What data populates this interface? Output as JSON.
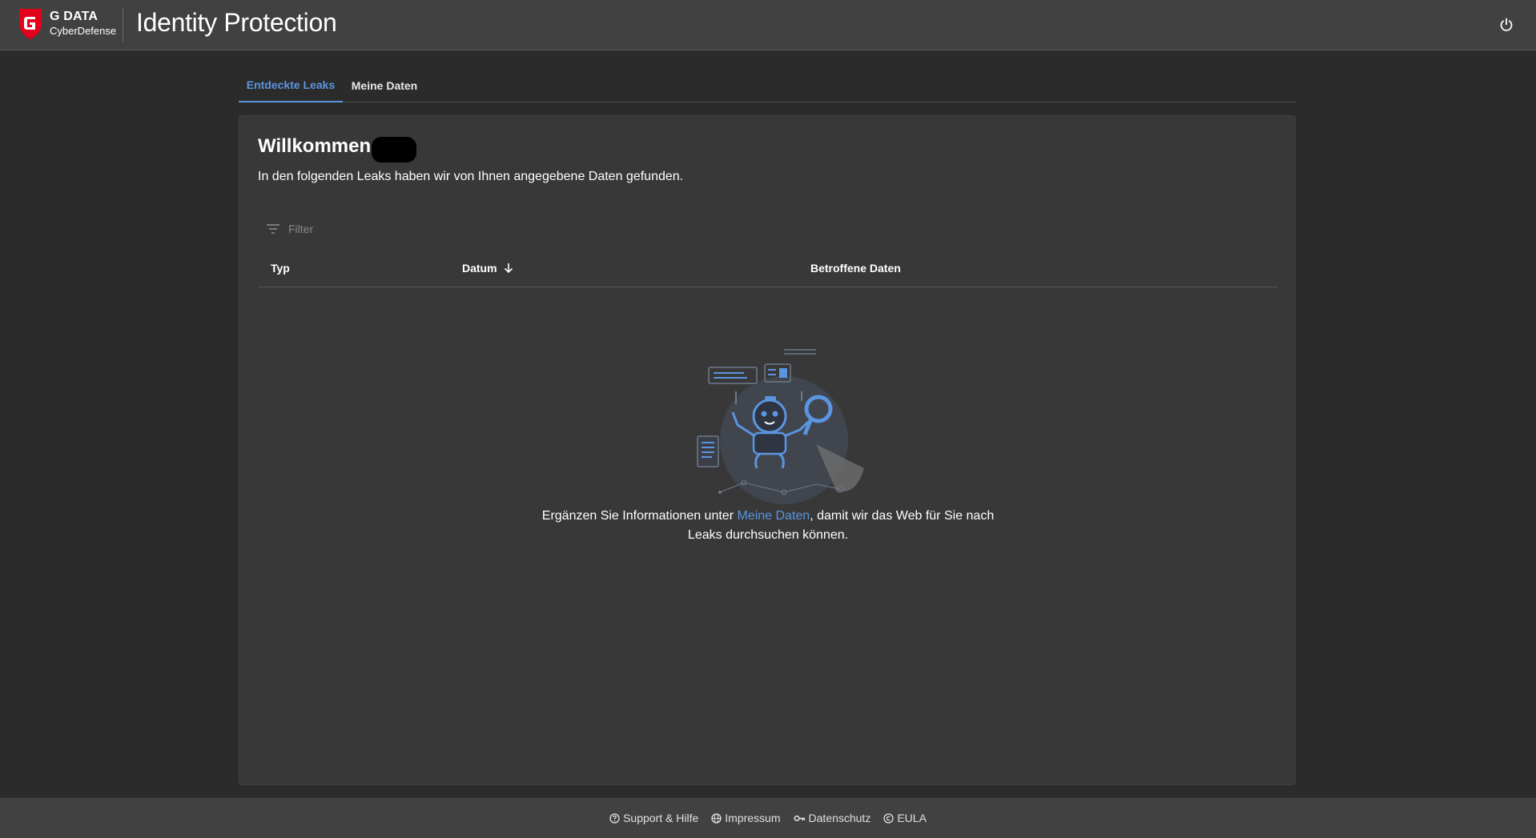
{
  "header": {
    "brand_line1": "G DATA",
    "brand_line2": "CyberDefense",
    "app_title": "Identity Protection",
    "power_icon": "power-icon"
  },
  "tabs": [
    {
      "label": "Entdeckte Leaks",
      "active": true
    },
    {
      "label": "Meine Daten",
      "active": false
    }
  ],
  "main": {
    "welcome": "Willkommen,",
    "subtitle": "In den folgenden Leaks haben wir von Ihnen angegebene Daten gefunden.",
    "filter_placeholder": "Filter",
    "columns": [
      "Typ",
      "Datum",
      "Betroffene Daten"
    ],
    "sort_icon": "arrow-down-icon",
    "empty": {
      "text_before": "Ergänzen Sie Informationen unter ",
      "link": "Meine Daten",
      "text_after": ", damit wir das Web für Sie nach Leaks durchsuchen können."
    }
  },
  "footer": [
    {
      "label": "Support & Hilfe",
      "icon": "help-circle-icon"
    },
    {
      "label": "Impressum",
      "icon": "globe-icon"
    },
    {
      "label": "Datenschutz",
      "icon": "key-icon"
    },
    {
      "label": "EULA",
      "icon": "copyright-icon"
    }
  ],
  "colors": {
    "accent": "#5b95e0",
    "brand_red": "#e3001b",
    "background": "#2b2b2b",
    "card": "#383838",
    "topbar": "#414141"
  }
}
